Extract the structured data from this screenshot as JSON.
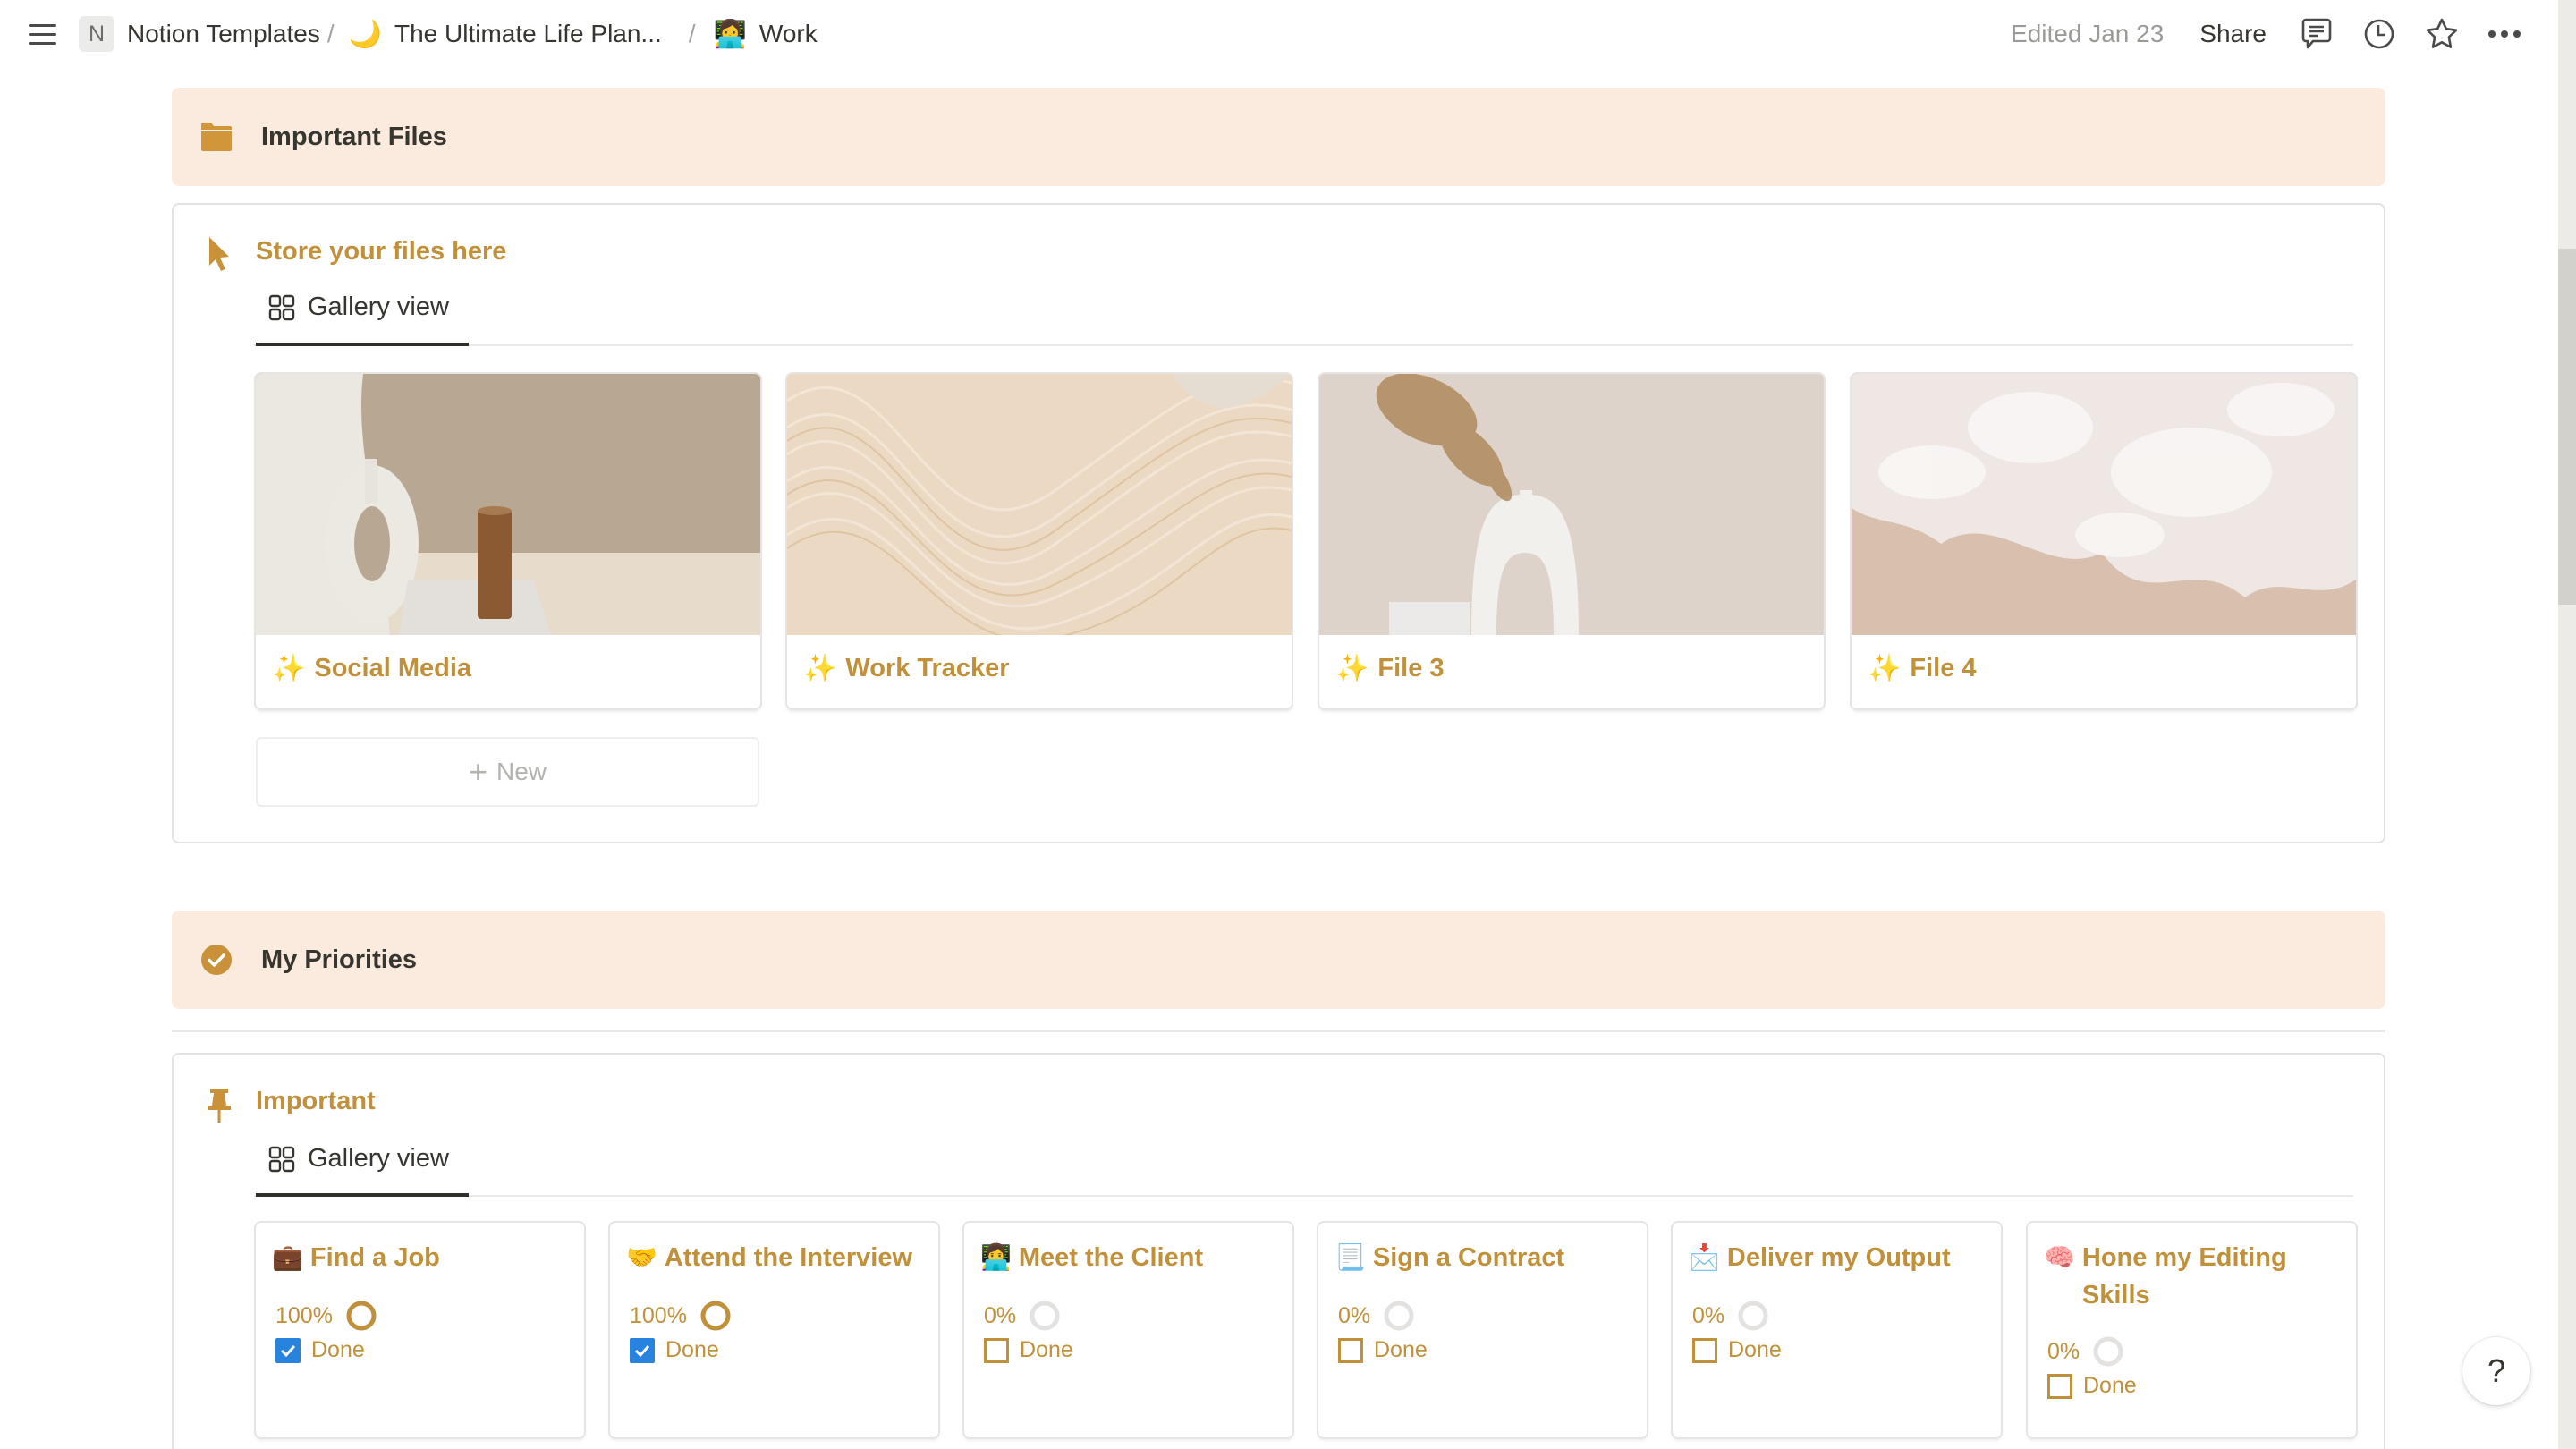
{
  "topbar": {
    "workspace_badge": "N",
    "breadcrumbs": [
      {
        "icon": "",
        "label": "Notion Templates"
      },
      {
        "icon": "🌙",
        "label": "The Ultimate Life Plan..."
      },
      {
        "icon": "👩‍💻",
        "label": "Work"
      }
    ],
    "separator": "/",
    "edited": "Edited Jan 23",
    "share": "Share",
    "icons": [
      "comments-icon",
      "history-clock-icon",
      "favorite-star-icon",
      "more-options-icon"
    ]
  },
  "files_section": {
    "callout_title": "Important Files",
    "callout_icon": "folder-icon",
    "database_title": "Store your files here",
    "database_icon": "cursor-arrow-icon",
    "view_tab": "Gallery view",
    "cards": [
      {
        "emoji": "✨",
        "title": "Social Media",
        "cover": "beige vase and candle"
      },
      {
        "emoji": "✨",
        "title": "Work Tracker",
        "cover": "beige brush strokes"
      },
      {
        "emoji": "✨",
        "title": "File 3",
        "cover": "white vase with pampas grass"
      },
      {
        "emoji": "✨",
        "title": "File 4",
        "cover": "sea foam on sand"
      }
    ],
    "new_button": "New"
  },
  "priorities_section": {
    "callout_title": "My Priorities",
    "callout_icon": "check-circle-icon",
    "database_title": "Important",
    "database_icon": "pushpin-icon",
    "view_tab": "Gallery view",
    "cards": [
      {
        "emoji": "💼",
        "title": "Find a Job",
        "progress_label": "100%",
        "progress": 1.0,
        "done_label": "Done",
        "done": true
      },
      {
        "emoji": "🤝",
        "title": "Attend the Interview",
        "progress_label": "100%",
        "progress": 1.0,
        "done_label": "Done",
        "done": true
      },
      {
        "emoji": "👩‍💻",
        "title": "Meet the Client",
        "progress_label": "0%",
        "progress": 0.0,
        "done_label": "Done",
        "done": false
      },
      {
        "emoji": "📃",
        "title": "Sign a Contract",
        "progress_label": "0%",
        "progress": 0.0,
        "done_label": "Done",
        "done": false
      },
      {
        "emoji": "📩",
        "title": "Deliver my Output",
        "progress_label": "0%",
        "progress": 0.0,
        "done_label": "Done",
        "done": false
      },
      {
        "emoji": "🧠",
        "title": "Hone my Editing Skills",
        "progress_label": "0%",
        "progress": 0.0,
        "done_label": "Done",
        "done": false
      }
    ]
  },
  "help_button": "?",
  "colors": {
    "accent": "#c0913a",
    "callout_bg": "#fbebdf",
    "checkbox_checked": "#2783de",
    "text": "#37352f",
    "muted": "#9b9a97"
  }
}
